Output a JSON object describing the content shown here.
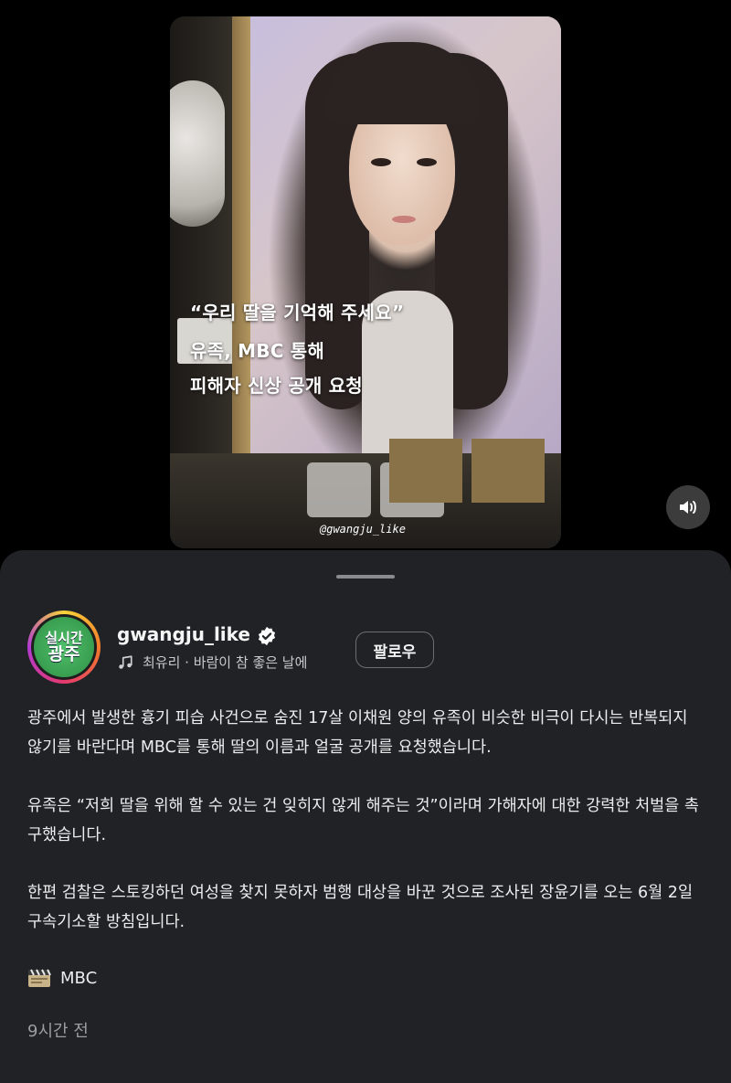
{
  "video": {
    "overlay_lines": [
      "“우리 딸을 기억해 주세요”",
      "유족, MBC 통해",
      "피해자 신상 공개 요청"
    ],
    "watermark": "@gwangju_like"
  },
  "account": {
    "username": "gwangju_like",
    "verified": true,
    "avatar_text_line1": "실시간",
    "avatar_text_line2": "광주",
    "music": "최유리 · 바람이 참 좋은 날에",
    "follow_label": "팔로우"
  },
  "caption": {
    "paragraphs": [
      "광주에서 발생한 흉기 피습 사건으로 숨진 17살 이채원 양의 유족이 비슷한 비극이 다시는 반복되지 않기를 바란다며 MBC를 통해 딸의 이름과 얼굴 공개를 요청했습니다.",
      "유족은 “저희 딸을 위해 할 수 있는 건 잊히지 않게 해주는 것”이라며 가해자에 대한 강력한 처벌을 촉구했습니다.",
      "한편 검찰은 스토킹하던 여성을 찾지 못하자 범행 대상을 바꾼 것으로 조사된 장윤기를 오는 6월 2일 구속기소할 방침입니다."
    ],
    "source": "MBC"
  },
  "timestamp": "9시간 전",
  "colors": {
    "sheet_bg": "#202226",
    "text": "#ededee",
    "muted": "#9d9ea2",
    "verified_badge": "#ffffff"
  },
  "icons": [
    "speaker-icon",
    "verified-badge-icon",
    "music-note-icon",
    "clapperboard-icon"
  ]
}
